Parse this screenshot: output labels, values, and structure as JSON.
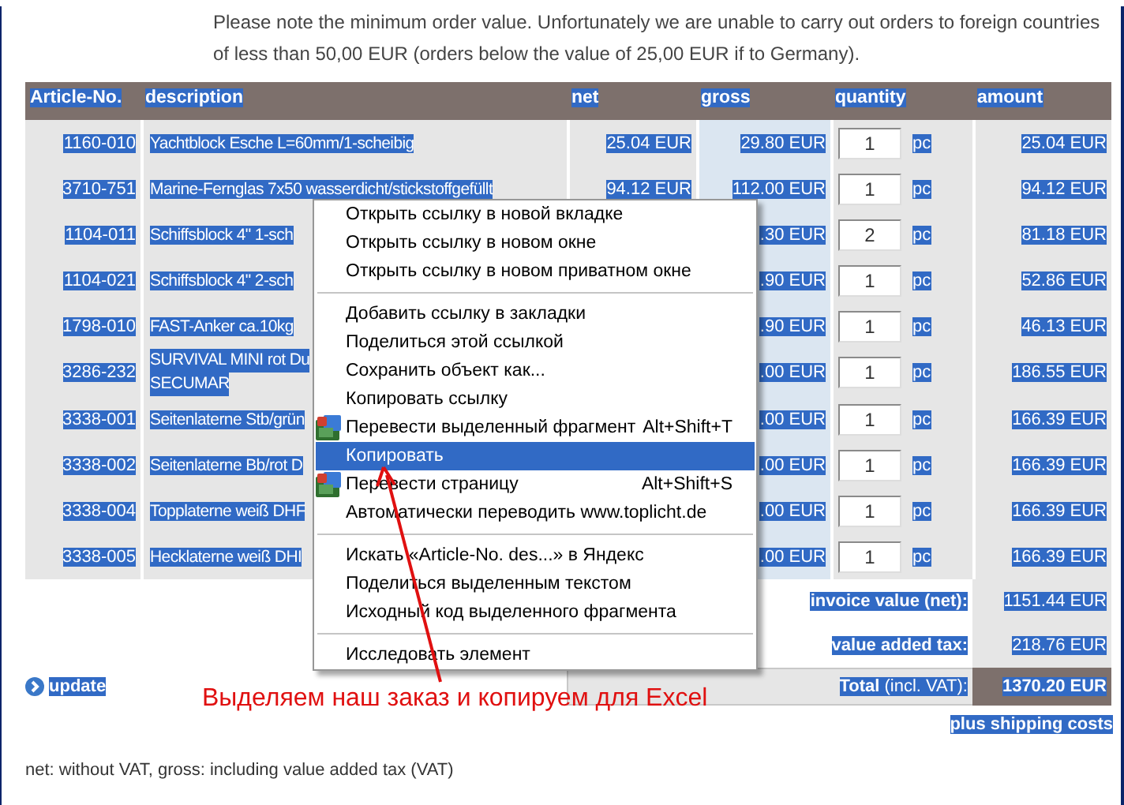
{
  "notice": "Please note the minimum order value. Unfortunately we are unable to carry out orders to foreign countries of less than 50,00 EUR (orders below the value of 25,00 EUR if to Germany).",
  "table": {
    "columns": [
      "Article-No.",
      "description",
      "net",
      "gross",
      "quantity",
      "amount"
    ],
    "rows": [
      {
        "article": "1160-010",
        "description": "Yachtblock Esche L=60mm/1-scheibig",
        "net": "25.04 EUR",
        "gross": "29.80 EUR",
        "quantity": "1",
        "unit": "pc",
        "amount": "25.04 EUR"
      },
      {
        "article": "3710-751",
        "description": "Marine-Fernglas 7x50 wasserdicht/stickstoffgefüllt",
        "net": "94.12 EUR",
        "gross": "112.00 EUR",
        "quantity": "1",
        "unit": "pc",
        "amount": "94.12 EUR"
      },
      {
        "article": "1104-011",
        "description": "Schiffsblock 4\" 1-sch",
        "gross": ".30 EUR",
        "quantity": "2",
        "unit": "pc",
        "amount": "81.18 EUR"
      },
      {
        "article": "1104-021",
        "description": "Schiffsblock 4\" 2-sch",
        "gross": ".90 EUR",
        "quantity": "1",
        "unit": "pc",
        "amount": "52.86 EUR"
      },
      {
        "article": "1798-010",
        "description": "FAST-Anker ca.10kg",
        "gross": ".90 EUR",
        "quantity": "1",
        "unit": "pc",
        "amount": "46.13 EUR"
      },
      {
        "article": "3286-232",
        "description": "SURVIVAL MINI rot Du",
        "description_2": "SECUMAR",
        "gross": ".00 EUR",
        "quantity": "1",
        "unit": "pc",
        "amount": "186.55 EUR"
      },
      {
        "article": "3338-001",
        "description": "Seitenlaterne Stb/grün",
        "gross": ".00 EUR",
        "quantity": "1",
        "unit": "pc",
        "amount": "166.39 EUR"
      },
      {
        "article": "3338-002",
        "description": "Seitenlaterne Bb/rot D",
        "gross": ".00 EUR",
        "quantity": "1",
        "unit": "pc",
        "amount": "166.39 EUR"
      },
      {
        "article": "3338-004",
        "description": "Topplaterne weiß DHF",
        "gross": ".00 EUR",
        "quantity": "1",
        "unit": "pc",
        "amount": "166.39 EUR"
      },
      {
        "article": "3338-005",
        "description": "Hecklaterne weiß DHI",
        "gross": ".00 EUR",
        "quantity": "1",
        "unit": "pc",
        "amount": "166.39 EUR"
      }
    ]
  },
  "summary": [
    {
      "kind": "subtotal",
      "label": "invoice value (net):",
      "value": "1151.44 EUR"
    },
    {
      "kind": "subtotal",
      "label": "value added tax:",
      "value": "218.76 EUR"
    },
    {
      "kind": "total",
      "label": "**Total** (incl. VAT):",
      "value": "1370.20 EUR"
    }
  ],
  "update_link": "update",
  "shipping_note": "plus shipping costs",
  "footnote": "net: without VAT, gross: including value added tax (VAT)",
  "context_menu": {
    "items": [
      {
        "kind": "item",
        "label": "Открыть ссылку в новой вкладке",
        "icon": false,
        "selected": false
      },
      {
        "kind": "item",
        "label": "Открыть ссылку в новом окне",
        "icon": false,
        "selected": false
      },
      {
        "kind": "item",
        "label": "Открыть ссылку в новом приватном окне",
        "icon": false,
        "selected": false
      },
      {
        "kind": "separator"
      },
      {
        "kind": "item",
        "label": "Добавить ссылку в закладки",
        "icon": false,
        "selected": false
      },
      {
        "kind": "item",
        "label": "Поделиться этой ссылкой",
        "icon": false,
        "selected": false
      },
      {
        "kind": "item",
        "label": "Сохранить объект как...",
        "icon": false,
        "selected": false
      },
      {
        "kind": "item",
        "label": "Копировать ссылку",
        "icon": false,
        "selected": false
      },
      {
        "kind": "item",
        "label": "Перевести выделенный фрагмент",
        "shortcut": "Alt+Shift+T",
        "icon": true,
        "selected": false
      },
      {
        "kind": "item",
        "label": "Копировать",
        "icon": false,
        "selected": true
      },
      {
        "kind": "item",
        "label": "Перевести страницу",
        "shortcut": "Alt+Shift+S",
        "icon": true,
        "selected": false
      },
      {
        "kind": "item",
        "label": "Автоматически переводить www.toplicht.de",
        "icon": false,
        "selected": false
      },
      {
        "kind": "separator"
      },
      {
        "kind": "item",
        "label": "Искать «Article-No. des...» в Яндекс",
        "icon": false,
        "selected": false
      },
      {
        "kind": "item",
        "label": "Поделиться выделенным текстом",
        "icon": false,
        "selected": false
      },
      {
        "kind": "item",
        "label": "Исходный код выделенного фрагмента",
        "icon": false,
        "selected": false
      },
      {
        "kind": "separator"
      },
      {
        "kind": "item",
        "label": "Исследовать элемент",
        "icon": false,
        "selected": false
      }
    ]
  },
  "annotation": "Выделяем наш заказ и копируем для Excel"
}
